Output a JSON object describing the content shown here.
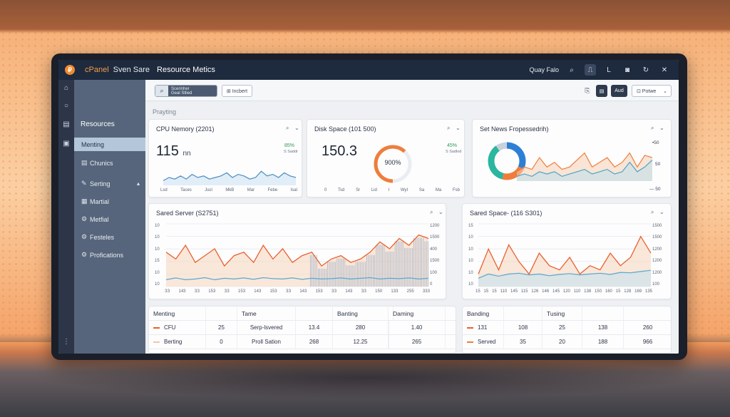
{
  "app": {
    "brand_glyph": "₽",
    "brand": "cPanel",
    "site": "Sven Sare",
    "title": "Resource Metics",
    "user": "Quay Falo",
    "top_icons": [
      "search-icon",
      "bookmark-icon",
      "pin-icon",
      "camera-icon",
      "refresh-icon",
      "close-icon"
    ],
    "top_glyphs": [
      "⌕",
      "⎍",
      "L",
      "◙",
      "↻",
      "✕"
    ]
  },
  "rail_glyphs": [
    "⌂",
    "○",
    "▤",
    "▣",
    "⋮"
  ],
  "sidebar": {
    "heading": "Resources",
    "items": [
      {
        "label": "Menting",
        "icon": ""
      },
      {
        "label": "Chunics",
        "icon": "▤"
      },
      {
        "label": "Serting",
        "icon": "✎",
        "chevron": "▴"
      },
      {
        "label": "Martial",
        "icon": "▦"
      },
      {
        "label": "Metfial",
        "icon": "⚙"
      },
      {
        "label": "Festeles",
        "icon": "⚙"
      },
      {
        "label": "Profications",
        "icon": "⚙"
      }
    ]
  },
  "toolbar": {
    "search_glyph": "⌕",
    "search_line1": "Scerinher",
    "search_line2": "Geal Stlied",
    "button_label": "⊞ Incbert",
    "icon1": "⎘",
    "icon2": "▤",
    "dark_btn": "Aud",
    "select_label": "⊡ Potwe",
    "select_chevron": "⌄"
  },
  "breadcrumb": "Prayting",
  "card_ctrls": {
    "search": "⌕",
    "chevron": "⌄"
  },
  "cards": {
    "cpu": {
      "title": "CPU Nemory (2201)",
      "value": "115",
      "unit": "nn",
      "delta": "85%",
      "delta_sub": "S Saddr",
      "ticks": [
        "Lsd",
        "Taces",
        "Jucl",
        "MkB",
        "Mar",
        "Febe",
        "Isal"
      ]
    },
    "disk": {
      "title": "Disk Space (101 500)",
      "value": "150.3",
      "gauge_label": "900%",
      "gauge_fraction": 0.62,
      "delta": "45%",
      "delta_sub": "S Sadlod",
      "ticks": [
        "0",
        "Tsd",
        "Sr",
        "Lid",
        "I",
        "WyI",
        "Sa",
        "Ma",
        "Fsb"
      ]
    },
    "news": {
      "title": "Set News Fropessedrih)",
      "y_labels": [
        "•50",
        "50",
        "— 50"
      ],
      "donut": [
        {
          "name": "segment-blue",
          "value": 0.32,
          "color": "#2d7fd6"
        },
        {
          "name": "segment-orange",
          "value": 0.22,
          "color": "#ef7d3c"
        },
        {
          "name": "segment-teal",
          "value": 0.36,
          "color": "#2bb6a0"
        },
        {
          "name": "segment-gray",
          "value": 0.1,
          "color": "#c9d2dc"
        }
      ]
    },
    "shared_server": {
      "title": "Sared Server (S2751)",
      "y_left": [
        "10",
        "10",
        "10",
        "15",
        "10",
        "10"
      ],
      "y_right": [
        "1200",
        "1500",
        "400",
        "1500",
        "100",
        "0"
      ],
      "x_ticks": [
        "ЗЗ",
        "143",
        "ЗЗ",
        "153",
        "ЗЗ",
        "153",
        "143",
        "153",
        "ЗЗ",
        "143",
        "153",
        "ЗЗ",
        "143",
        "ЗЗ",
        "150",
        "133",
        "255",
        "333"
      ]
    },
    "shared_space": {
      "title": "Sared Space- (116 S301)",
      "y_left": [
        "15",
        "10",
        "10",
        "10",
        "10",
        "10"
      ],
      "y_right": [
        "1500",
        "1500",
        "1200",
        "1200",
        "1200",
        "100"
      ],
      "x_ticks": [
        "15",
        "15",
        "15",
        "110",
        "145",
        "115",
        "126",
        "146",
        "145",
        "120",
        "110",
        "138",
        "150",
        "160",
        "15",
        "128",
        "169",
        "135"
      ]
    }
  },
  "chart_data": [
    {
      "type": "area",
      "title": "CPU Nemory (2201)",
      "categories": [
        "Lsd",
        "Taces",
        "Jucl",
        "MkB",
        "Mar",
        "Febe",
        "Isal"
      ],
      "series": [
        {
          "values": [
            3,
            5,
            4,
            6,
            4,
            7,
            5,
            6,
            4,
            5,
            6,
            8,
            5,
            7,
            6,
            4,
            5,
            9,
            6,
            7,
            5,
            8,
            6,
            5
          ],
          "color": "#4a8fc2"
        }
      ]
    },
    {
      "type": "area",
      "title": "Set News Fropessedrih)",
      "series": [
        {
          "values": [
            2,
            3,
            2.5,
            5,
            3,
            4,
            2.5,
            3,
            4.5,
            6,
            3,
            4,
            5,
            3,
            4,
            6,
            3,
            5.5,
            5
          ],
          "color": "#ef7d3c"
        },
        {
          "values": [
            1,
            1.5,
            1,
            2,
            1.5,
            2,
            1,
            1.5,
            2,
            2.5,
            1.5,
            2,
            2.5,
            1.5,
            2,
            4,
            2,
            3,
            4.5
          ],
          "color": "#4aa3c8"
        }
      ]
    },
    {
      "type": "line",
      "title": "Sared Server (S2751)",
      "series": [
        {
          "name": "orange",
          "values": [
            10,
            8,
            12,
            7,
            9,
            11,
            6,
            9,
            10,
            7,
            12,
            8,
            11,
            7,
            9,
            10,
            6,
            8,
            9,
            7,
            8,
            10,
            13,
            11,
            14,
            12,
            15,
            14
          ],
          "color": "#e9602e"
        },
        {
          "name": "blue",
          "values": [
            2,
            2.5,
            2,
            2.2,
            2.6,
            2,
            2.4,
            2.2,
            2.5,
            2.1,
            2.6,
            2.3,
            2.2,
            2.5,
            2.1,
            2.4,
            2.2,
            2.3,
            2.5,
            2.2,
            2.4,
            2.6,
            2.2,
            2.4,
            2.3,
            2.5,
            2.2,
            2.4
          ],
          "color": "#5aa7cf"
        }
      ]
    },
    {
      "type": "line",
      "title": "Sared Space- (116 S301)",
      "series": [
        {
          "name": "orange",
          "values": [
            3,
            9,
            4,
            10,
            6,
            3,
            8,
            5,
            4,
            7,
            3,
            5,
            4,
            8,
            5,
            7,
            12,
            8
          ],
          "color": "#e9602e"
        },
        {
          "name": "blue",
          "values": [
            2,
            3,
            2.5,
            3,
            3.2,
            2.8,
            3,
            2.6,
            2.9,
            3.1,
            2.8,
            3,
            3.2,
            2.9,
            3.4,
            3.3,
            3.6,
            3.9
          ],
          "color": "#5aa7cf"
        }
      ]
    }
  ],
  "table_left": {
    "headers": [
      "Menting",
      "",
      "Tame",
      "",
      "Banting",
      "",
      "Daming",
      ""
    ],
    "rows": [
      {
        "swatch": "#e9602e",
        "cells": [
          "CFU",
          "25",
          "Serp-lsvered",
          "13.4",
          "280",
          "",
          "1.40",
          ""
        ]
      },
      {
        "swatch": "#f3c7a3",
        "cells": [
          "Berting",
          "0",
          "Proll Sation",
          "268",
          "12.25",
          "",
          "265",
          ""
        ]
      }
    ]
  },
  "table_right": {
    "headers": [
      "Banding",
      "",
      "Tusing",
      "",
      ""
    ],
    "rows": [
      {
        "swatch": "#e9602e",
        "cells": [
          "131",
          "108",
          "25",
          "138",
          "260"
        ]
      },
      {
        "swatch": "#ef7d3c",
        "cells": [
          "Served",
          "35",
          "20",
          "188",
          "966"
        ]
      }
    ]
  }
}
